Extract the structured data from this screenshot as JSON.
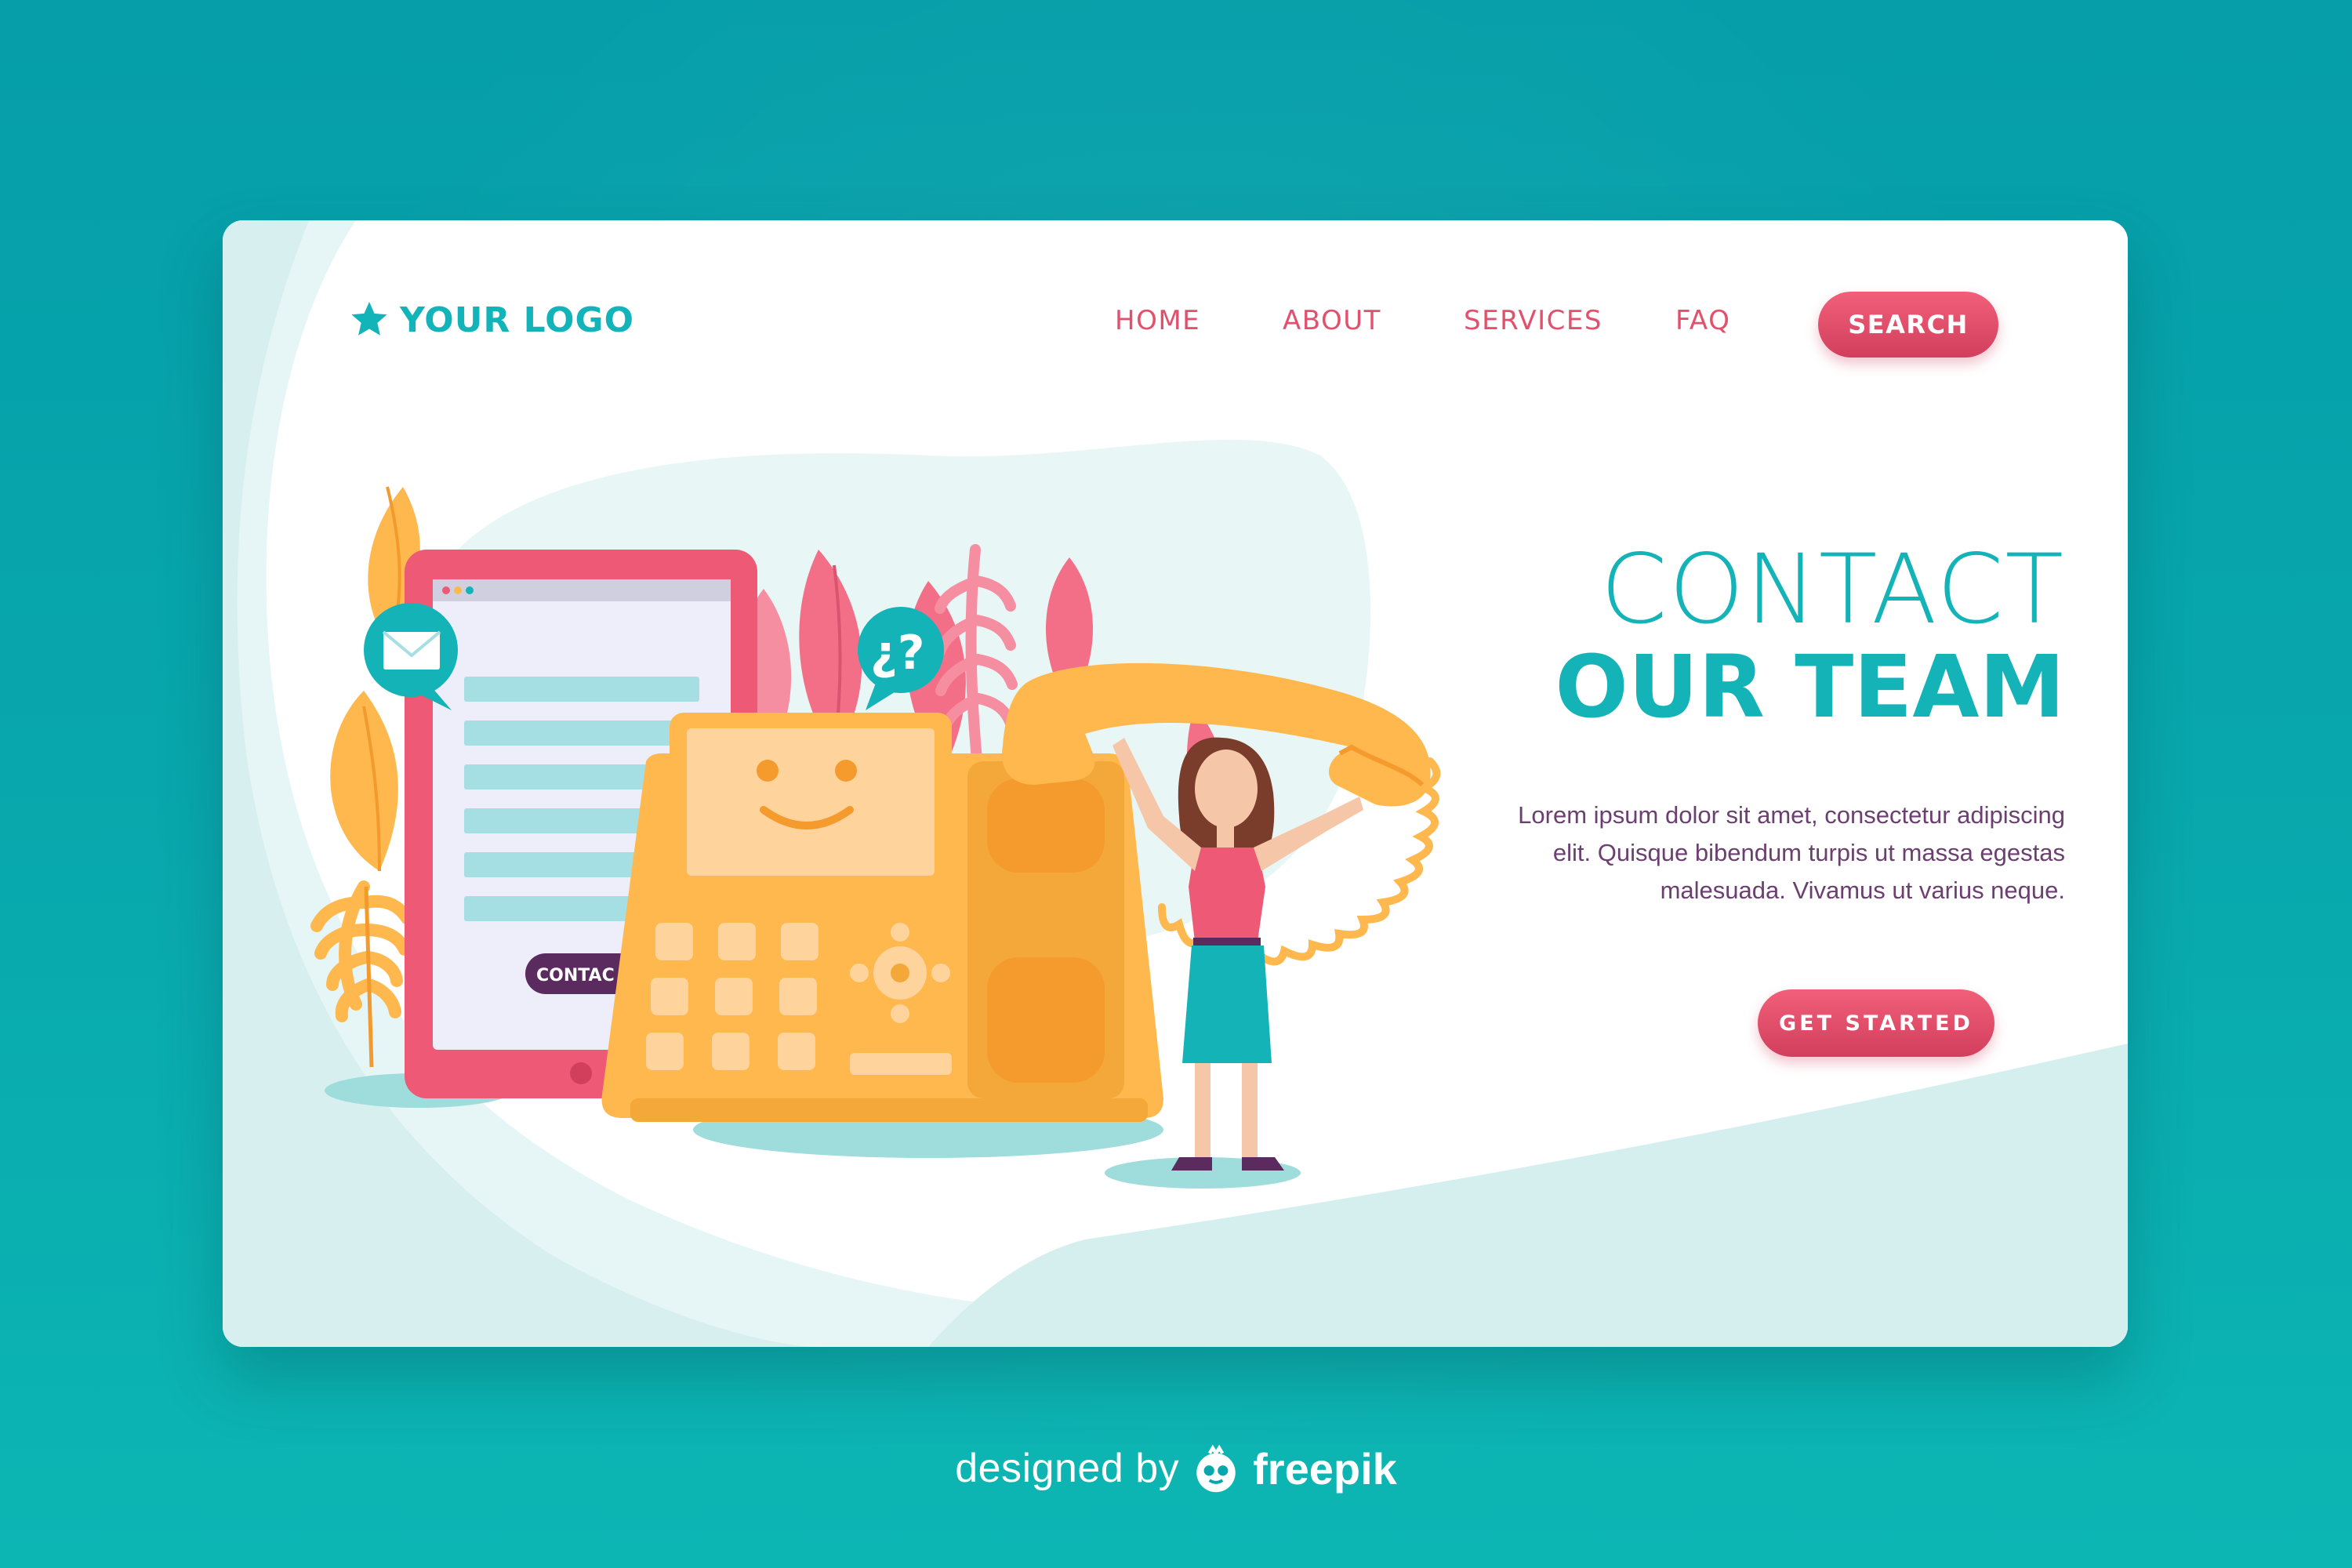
{
  "colors": {
    "page_bg": "#08a7ad",
    "accent_teal": "#13b3b8",
    "accent_pink": "#e2506d",
    "body_text": "#6b3f70",
    "card_bg": "#ffffff"
  },
  "header": {
    "logo_icon": "star-icon",
    "logo_text": "YOUR LOGO",
    "menu": [
      {
        "label": "HOME"
      },
      {
        "label": "ABOUT"
      },
      {
        "label": "SERVICES"
      },
      {
        "label": "FAQ"
      }
    ],
    "search_label": "SEARCH"
  },
  "hero": {
    "headline_line1": "CONTACT",
    "headline_line2": "OUR TEAM",
    "body": "Lorem ipsum dolor sit amet, consectetur adipiscing elit. Quisque bibendum turpis ut massa egestas malesuada. Vivamus ut varius neque.",
    "cta_label": "GET STARTED"
  },
  "illustration": {
    "tablet_button_label": "CONTAC",
    "question_bubble_text": "¿?",
    "icons": [
      "envelope-icon",
      "question-icon",
      "smiley-screen-icon"
    ]
  },
  "credit": {
    "prefix": "designed by",
    "brand": "freepik",
    "brand_icon": "freepik-logo-icon"
  }
}
